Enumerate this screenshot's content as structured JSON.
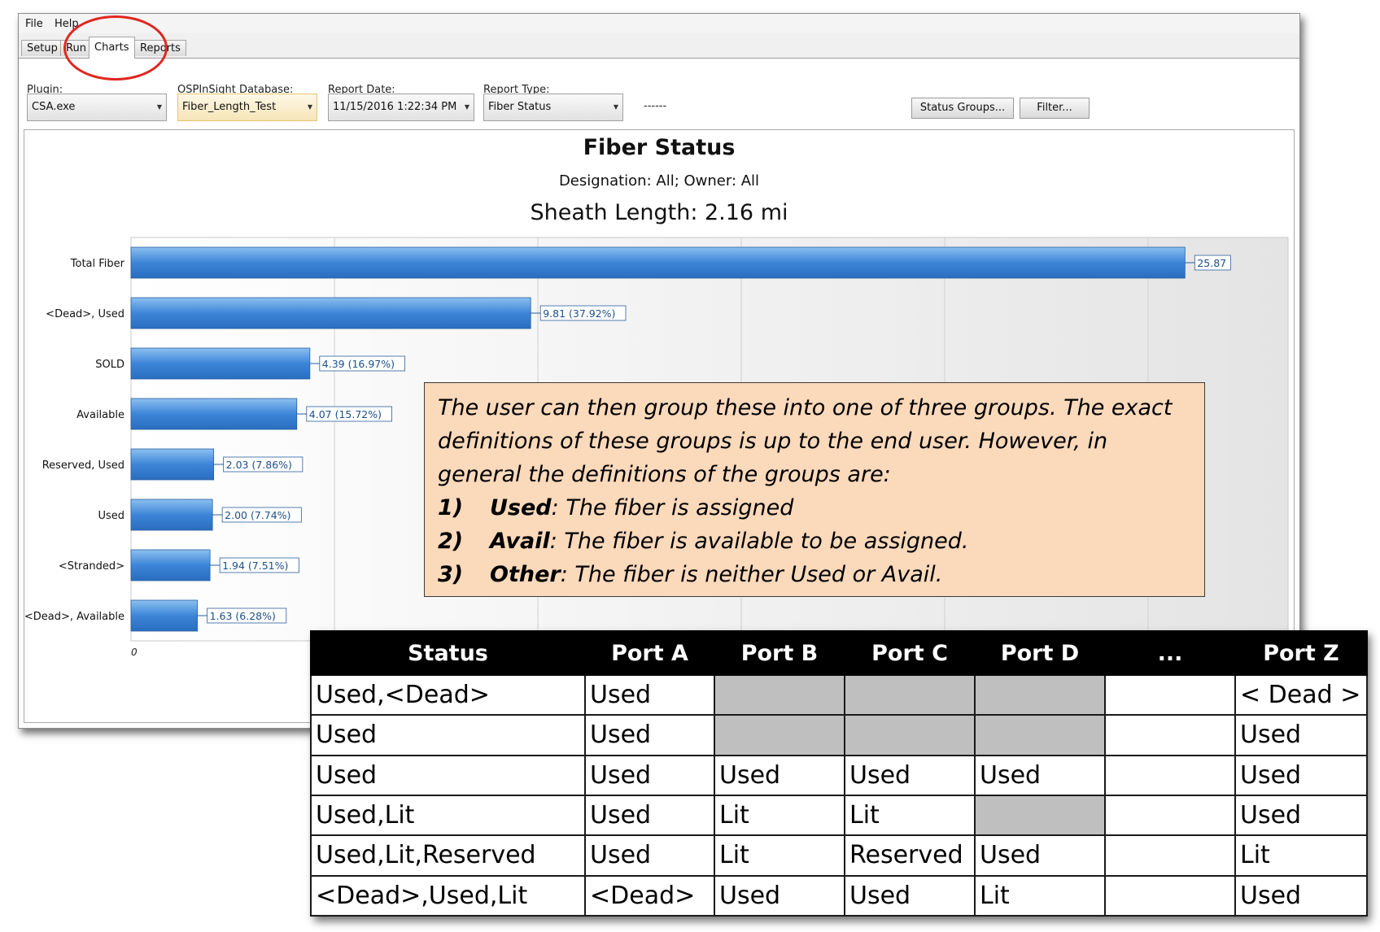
{
  "menu": [
    "File",
    "Help"
  ],
  "tabs": [
    {
      "label": "Setup",
      "active": false
    },
    {
      "label": "Run",
      "active": false
    },
    {
      "label": "Charts",
      "active": true
    },
    {
      "label": "Reports",
      "active": false
    }
  ],
  "toolbar": {
    "plugin_label": "Plugin:",
    "plugin_value": "CSA.exe",
    "database_label": "OSPInSight Database:",
    "database_value": "Fiber_Length_Test",
    "date_label": "Report Date:",
    "date_value": "11/15/2016 1:22:34 PM",
    "type_label": "Report Type:",
    "type_value": "Fiber Status",
    "dashes": "------",
    "status_groups_button": "Status Groups...",
    "filter_button": "Filter..."
  },
  "chart": {
    "title": "Fiber Status",
    "subtitle": "Designation: All; Owner: All",
    "subtitle2": "Sheath Length: 2.16 mi"
  },
  "chart_data": {
    "type": "bar",
    "orientation": "horizontal",
    "title": "Fiber Status",
    "subtitle": "Designation: All; Owner: All",
    "categories": [
      "Total Fiber",
      "<Dead>, Used",
      "SOLD",
      "Available",
      "Reserved, Used",
      "Used",
      "<Stranded>",
      "<Dead>, Available"
    ],
    "values": [
      25.87,
      9.81,
      4.39,
      4.07,
      2.03,
      2.0,
      1.94,
      1.63
    ],
    "data_labels": [
      "25.87",
      "9.81 (37.92%)",
      "4.39 (16.97%)",
      "4.07 (15.72%)",
      "2.03 (7.86%)",
      "2.00 (7.74%)",
      "1.94 (7.51%)",
      "1.63 (6.28%)"
    ],
    "x_ticks": [
      "0"
    ],
    "xlim": [
      0,
      28.4
    ],
    "grid": true,
    "bar_color": "#3d85d8"
  },
  "callout": {
    "intro": "The user can then group these into one of three groups.  The exact definitions of these groups is up to the end user.  However, in general the definitions of the groups are:",
    "items": [
      {
        "num": "1)",
        "term": "Used",
        "text": ": The fiber is assigned"
      },
      {
        "num": "2)",
        "term": "Avail",
        "text": ": The fiber is available to be assigned."
      },
      {
        "num": "3)",
        "term": "Other",
        "text": ":  The fiber is neither Used or Avail."
      }
    ]
  },
  "status_table": {
    "headers": [
      "Status",
      "Port A",
      "Port B",
      "Port C",
      "Port D",
      "...",
      "Port Z"
    ],
    "rows": [
      [
        "Used,<Dead>",
        "Used",
        null,
        null,
        null,
        "",
        "< Dead >"
      ],
      [
        "Used",
        "Used",
        null,
        null,
        null,
        "",
        "Used"
      ],
      [
        "Used",
        "Used",
        "Used",
        "Used",
        "Used",
        "",
        "Used"
      ],
      [
        "Used,Lit",
        "Used",
        "Lit",
        "Lit",
        null,
        "",
        "Used"
      ],
      [
        "Used,Lit,Reserved",
        "Used",
        "Lit",
        "Reserved",
        "Used",
        "",
        "Lit"
      ],
      [
        "<Dead>,Used,Lit",
        "<Dead>",
        "Used",
        "Used",
        "Lit",
        "",
        "Used"
      ]
    ]
  },
  "colors": {
    "accent_circle": "#e0261f",
    "callout_bg": "#fbd9bb",
    "bar": "#3d85d8",
    "empty_cell": "#bfbfbf"
  }
}
